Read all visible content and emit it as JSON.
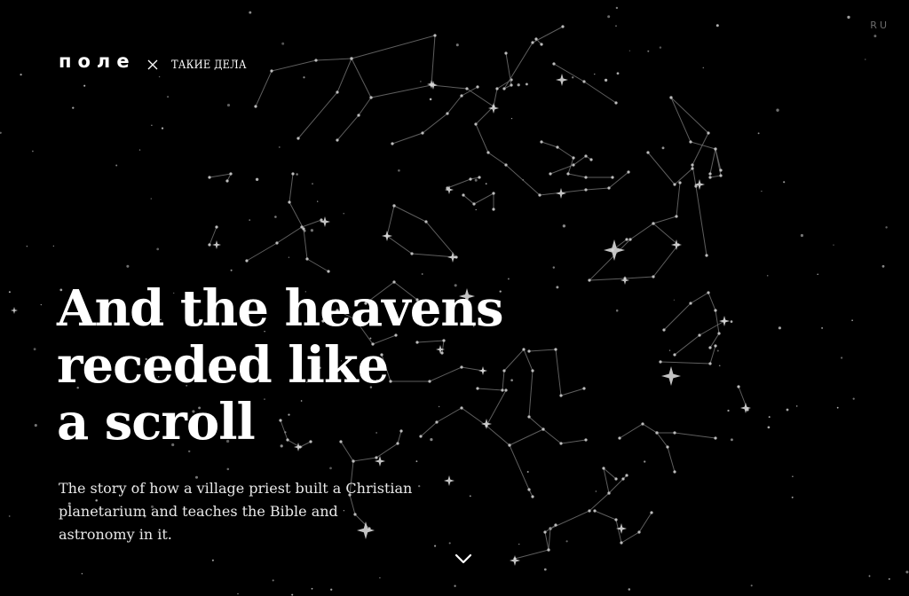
{
  "header": {
    "logo_primary": "поле",
    "logo_separator": "×",
    "logo_partner": "ТАКИЕ ДЕЛА",
    "language_switch": "RU"
  },
  "hero": {
    "title_lines": [
      "And the heavens",
      "receded like",
      "a scroll"
    ],
    "subtitle_lines": [
      "The story of how a village priest built a Christian",
      "planetarium and teaches the Bible and",
      "astronomy in it."
    ]
  },
  "icons": {
    "scroll_down": "chevron-down-icon",
    "separator": "close-icon"
  },
  "colors": {
    "background": "#000000",
    "text": "#ffffff",
    "constellation_lines": "#6f6f6f",
    "stars": "#bdbdbd",
    "language_switch": "#6c6c6c"
  }
}
